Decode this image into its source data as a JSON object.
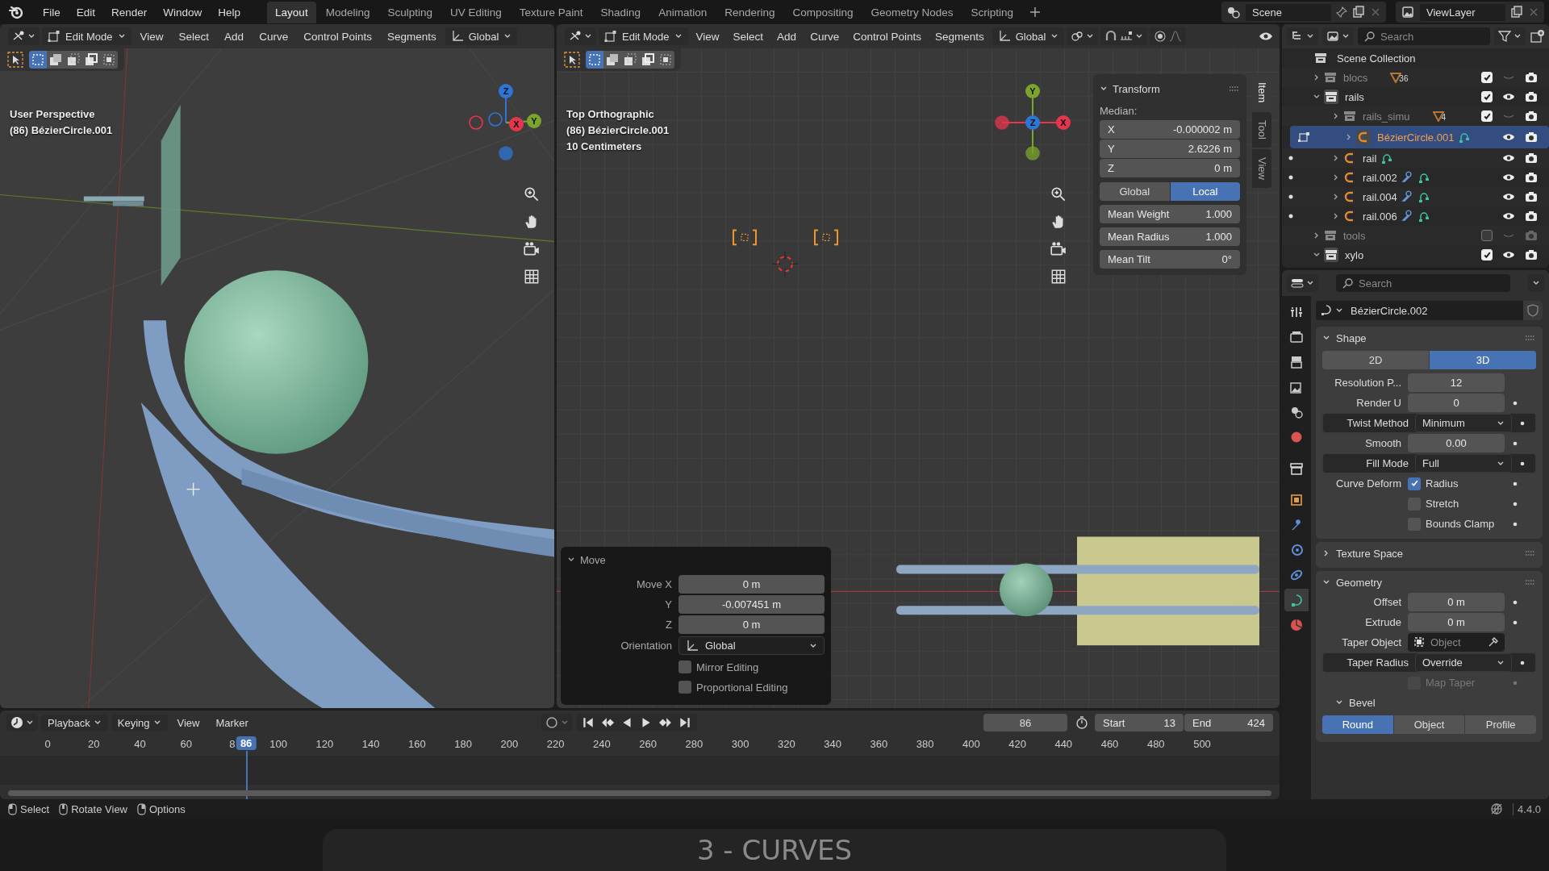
{
  "menu": [
    "File",
    "Edit",
    "Render",
    "Window",
    "Help"
  ],
  "workspaces": [
    {
      "label": "Layout",
      "selected": true
    },
    {
      "label": "Modeling",
      "selected": false
    },
    {
      "label": "Sculpting",
      "selected": false
    },
    {
      "label": "UV Editing",
      "selected": false
    },
    {
      "label": "Texture Paint",
      "selected": false
    },
    {
      "label": "Shading",
      "selected": false
    },
    {
      "label": "Animation",
      "selected": false
    },
    {
      "label": "Rendering",
      "selected": false
    },
    {
      "label": "Compositing",
      "selected": false
    },
    {
      "label": "Geometry Nodes",
      "selected": false
    },
    {
      "label": "Scripting",
      "selected": false
    }
  ],
  "scene": "Scene",
  "view_layer": "ViewLayer",
  "viewports": [
    {
      "kind": "perspective",
      "mode": "Edit Mode",
      "menus": [
        "View",
        "Select",
        "Add",
        "Curve",
        "Control Points",
        "Segments"
      ],
      "orientation": "Global",
      "select_modes": [
        true,
        false,
        false,
        false,
        false
      ],
      "info": [
        "User Perspective",
        "(86) BézierCircle.001"
      ],
      "gizmo": [
        {
          "label": "Z",
          "color": "#2e75d6"
        },
        {
          "label": "X",
          "color": "#e5364f"
        },
        {
          "label": "Y",
          "color": "#7aa52c"
        }
      ]
    },
    {
      "kind": "top",
      "snap": {
        "on": false
      },
      "proportional": {
        "on": false
      },
      "mode": "Edit Mode",
      "menus": [
        "View",
        "Select",
        "Add",
        "Curve",
        "Control Points",
        "Segments"
      ],
      "orientation": "Global",
      "select_modes": [
        true,
        false,
        false,
        false,
        false
      ],
      "info": [
        "Top Orthographic",
        "(86) BézierCircle.001",
        "10 Centimeters"
      ],
      "gizmo": [
        {
          "label": "Y",
          "color": "#7aa52c"
        },
        {
          "label": "Z",
          "color": "#2e75d6"
        },
        {
          "label": "X",
          "color": "#e5364f"
        }
      ],
      "sidebar_tabs": [
        {
          "label": "Item",
          "selected": true
        },
        {
          "label": "Tool",
          "selected": false
        },
        {
          "label": "View",
          "selected": false
        }
      ],
      "transform": {
        "title": "Transform",
        "expanded": true,
        "median_label": "Median:",
        "fields": [
          {
            "label": "X",
            "value": "-0.000002 m"
          },
          {
            "label": "Y",
            "value": "2.6226 m"
          },
          {
            "label": "Z",
            "value": "0 m"
          }
        ],
        "space": [
          {
            "label": "Global",
            "selected": false
          },
          {
            "label": "Local",
            "selected": true
          }
        ],
        "props": [
          {
            "label": "Mean Weight",
            "value": "1.000"
          },
          {
            "label": "Mean Radius",
            "value": "1.000"
          },
          {
            "label": "Mean Tilt",
            "value": "0°"
          }
        ]
      },
      "last_operator": {
        "title": "Move",
        "expanded": true,
        "fields": [
          {
            "label": "Move X",
            "value": "0 m"
          },
          {
            "label": "Y",
            "value": "-0.007451 m"
          },
          {
            "label": "Z",
            "value": "0 m"
          }
        ],
        "orientation": {
          "label": "Orientation",
          "value": "Global"
        },
        "options": [
          {
            "label": "Mirror Editing",
            "checked": false
          },
          {
            "label": "Proportional Editing",
            "checked": false
          }
        ]
      }
    }
  ],
  "outliner": {
    "search_placeholder": "Search",
    "root": "Scene Collection",
    "items": [
      {
        "kind": "collection",
        "name": "blocs",
        "expanded": false,
        "included": true,
        "visible": false,
        "count": "36"
      },
      {
        "kind": "collection",
        "name": "rails",
        "expanded": true,
        "included": true,
        "visible": true,
        "children": [
          {
            "kind": "collection",
            "name": "rails_simu",
            "expanded": false,
            "included": true,
            "visible": false,
            "count": "4"
          },
          {
            "kind": "curve",
            "name": "BézierCircle.001",
            "selected": true,
            "modifier": false,
            "visible": true
          },
          {
            "kind": "curve",
            "name": "rail",
            "selected": false,
            "modifier": false,
            "visible": true
          },
          {
            "kind": "curve",
            "name": "rail.002",
            "selected": false,
            "modifier": true,
            "visible": true
          },
          {
            "kind": "curve",
            "name": "rail.004",
            "selected": false,
            "modifier": true,
            "visible": true
          },
          {
            "kind": "curve",
            "name": "rail.006",
            "selected": false,
            "modifier": true,
            "visible": true
          }
        ]
      },
      {
        "kind": "collection",
        "name": "tools",
        "expanded": false,
        "included": false,
        "visible": false
      },
      {
        "kind": "collection",
        "name": "xylo",
        "expanded": true,
        "included": true,
        "visible": true
      }
    ]
  },
  "properties": {
    "search_placeholder": "Search",
    "datablock": "BézierCircle.002",
    "tabs": [
      {
        "kind": "tool",
        "selected": false
      },
      {
        "kind": "render",
        "selected": false
      },
      {
        "kind": "output",
        "selected": false
      },
      {
        "kind": "view_layer",
        "selected": false
      },
      {
        "kind": "scene",
        "selected": false
      },
      {
        "kind": "world",
        "selected": false
      },
      {
        "kind": "collection",
        "selected": false
      },
      {
        "kind": "object",
        "selected": false
      },
      {
        "kind": "modifiers",
        "selected": false
      },
      {
        "kind": "physics",
        "selected": false
      },
      {
        "kind": "constraints",
        "selected": false
      },
      {
        "kind": "data",
        "selected": true
      },
      {
        "kind": "material",
        "selected": false
      }
    ],
    "panels": [
      {
        "title": "Shape",
        "expanded": true,
        "rows": [
          {
            "kind": "toggle",
            "options": [
              {
                "label": "2D",
                "selected": false
              },
              {
                "label": "3D",
                "selected": true
              }
            ]
          },
          {
            "kind": "number",
            "label": "Resolution P...",
            "value": "12",
            "animatable": false
          },
          {
            "kind": "number",
            "label": "Render U",
            "value": "0",
            "animatable": true
          },
          {
            "kind": "dropdown",
            "label": "Twist Method",
            "value": "Minimum",
            "animatable": true
          },
          {
            "kind": "number",
            "label": "Smooth",
            "value": "0.00",
            "animatable": true
          },
          {
            "kind": "dropdown",
            "label": "Fill Mode",
            "value": "Full",
            "animatable": true
          },
          {
            "kind": "checkbox",
            "label": "Curve Deform",
            "text": "Radius",
            "checked": true,
            "disabled": false,
            "animatable": true
          },
          {
            "kind": "checkbox",
            "text": "Stretch",
            "checked": false,
            "disabled": false,
            "animatable": true
          },
          {
            "kind": "checkbox",
            "text": "Bounds Clamp",
            "checked": false,
            "disabled": false,
            "animatable": true
          }
        ]
      },
      {
        "title": "Texture Space",
        "expanded": false
      },
      {
        "title": "Geometry",
        "expanded": true,
        "rows": [
          {
            "kind": "number",
            "label": "Offset",
            "value": "0 m",
            "animatable": true
          },
          {
            "kind": "number",
            "label": "Extrude",
            "value": "0 m",
            "animatable": true
          },
          {
            "kind": "object",
            "label": "Taper Object",
            "placeholder": "Object"
          },
          {
            "kind": "dropdown",
            "label": "Taper Radius",
            "value": "Override",
            "animatable": true
          },
          {
            "kind": "checkbox",
            "text": "Map Taper",
            "checked": false,
            "disabled": true,
            "animatable": true
          }
        ],
        "subpanels": [
          {
            "title": "Bevel",
            "expanded": true,
            "rows": [
              {
                "kind": "toggle",
                "options": [
                  {
                    "label": "Round",
                    "selected": true
                  },
                  {
                    "label": "Object",
                    "selected": false
                  },
                  {
                    "label": "Profile",
                    "selected": false
                  }
                ]
              }
            ]
          }
        ]
      }
    ]
  },
  "timeline": {
    "menus": [
      "Playback",
      "Keying",
      "View",
      "Marker"
    ],
    "auto_keying": {
      "on": false
    },
    "current_frame": "86",
    "start": {
      "label": "Start",
      "value": "13"
    },
    "end": {
      "label": "End",
      "value": "424"
    },
    "ruler": [
      "0",
      "20",
      "40",
      "60",
      "8",
      "100",
      "120",
      "140",
      "160",
      "180",
      "200",
      "220",
      "240",
      "260",
      "280",
      "300",
      "320",
      "340",
      "360",
      "380",
      "400",
      "420",
      "440",
      "460",
      "480",
      "500"
    ],
    "playhead": {
      "frame": "86",
      "level": 0.172
    }
  },
  "status": {
    "hints": [
      "Select",
      "Rotate View",
      "Options"
    ],
    "version": "4.4.0"
  },
  "caption": "3 - CURVES"
}
